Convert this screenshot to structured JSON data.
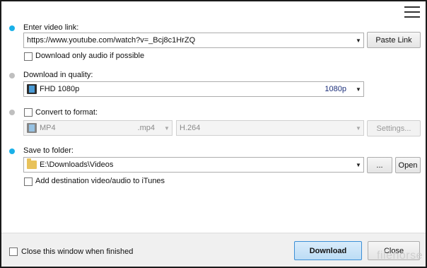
{
  "header": {
    "menu_icon": "hamburger-menu-icon"
  },
  "video_link": {
    "label": "Enter video link:",
    "value": "https://www.youtube.com/watch?v=_Bcj8c1HrZQ",
    "paste_label": "Paste Link",
    "audio_only_label": "Download only audio if possible",
    "audio_only_checked": false
  },
  "quality": {
    "label": "Download in quality:",
    "value": "FHD 1080p",
    "tag": "1080p",
    "icon": "film-icon",
    "tag_color": "#1c2f7a"
  },
  "convert": {
    "label": "Convert to format:",
    "checked": false,
    "format_value": "MP4",
    "format_ext": ".mp4",
    "codec_value": "H.264",
    "settings_label": "Settings..."
  },
  "save": {
    "label": "Save to folder:",
    "value": "E:\\Downloads\\Videos",
    "icon": "folder-icon",
    "browse_label": "...",
    "open_label": "Open",
    "itunes_label": "Add destination video/audio to iTunes",
    "itunes_checked": false
  },
  "footer": {
    "close_when_finished_label": "Close this window when finished",
    "download_label": "Download",
    "close_label": "Close"
  },
  "watermark": "filehorse",
  "colors": {
    "accent": "#1ab0e8",
    "primary_border": "#3c8fd6"
  }
}
